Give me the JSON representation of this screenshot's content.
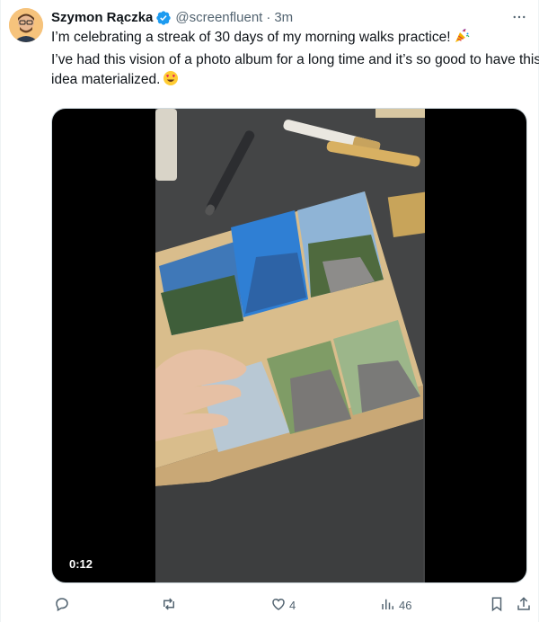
{
  "author": {
    "name": "Szymon Rączka",
    "handle": "@screenfluent",
    "separator": "·",
    "time": "3m"
  },
  "tweet": {
    "line1": "I’m celebrating a streak of 30 days of my morning walks practice!",
    "line2": "I’ve had this vision of a photo album for a long time and it’s so good to have this",
    "line3": "idea materialized."
  },
  "media": {
    "duration": "0:12"
  },
  "actions": {
    "replies": "",
    "retweets": "",
    "likes": "4",
    "views": "46"
  },
  "colors": {
    "verified": "#1d9bf0",
    "muted_text": "#536471",
    "primary_text": "#0f1419"
  },
  "icons": [
    "verified-badge-icon",
    "more-icon",
    "party-popper-icon",
    "heart-eyes-icon",
    "reply-icon",
    "retweet-icon",
    "like-icon",
    "views-icon",
    "bookmark-icon",
    "share-icon"
  ]
}
